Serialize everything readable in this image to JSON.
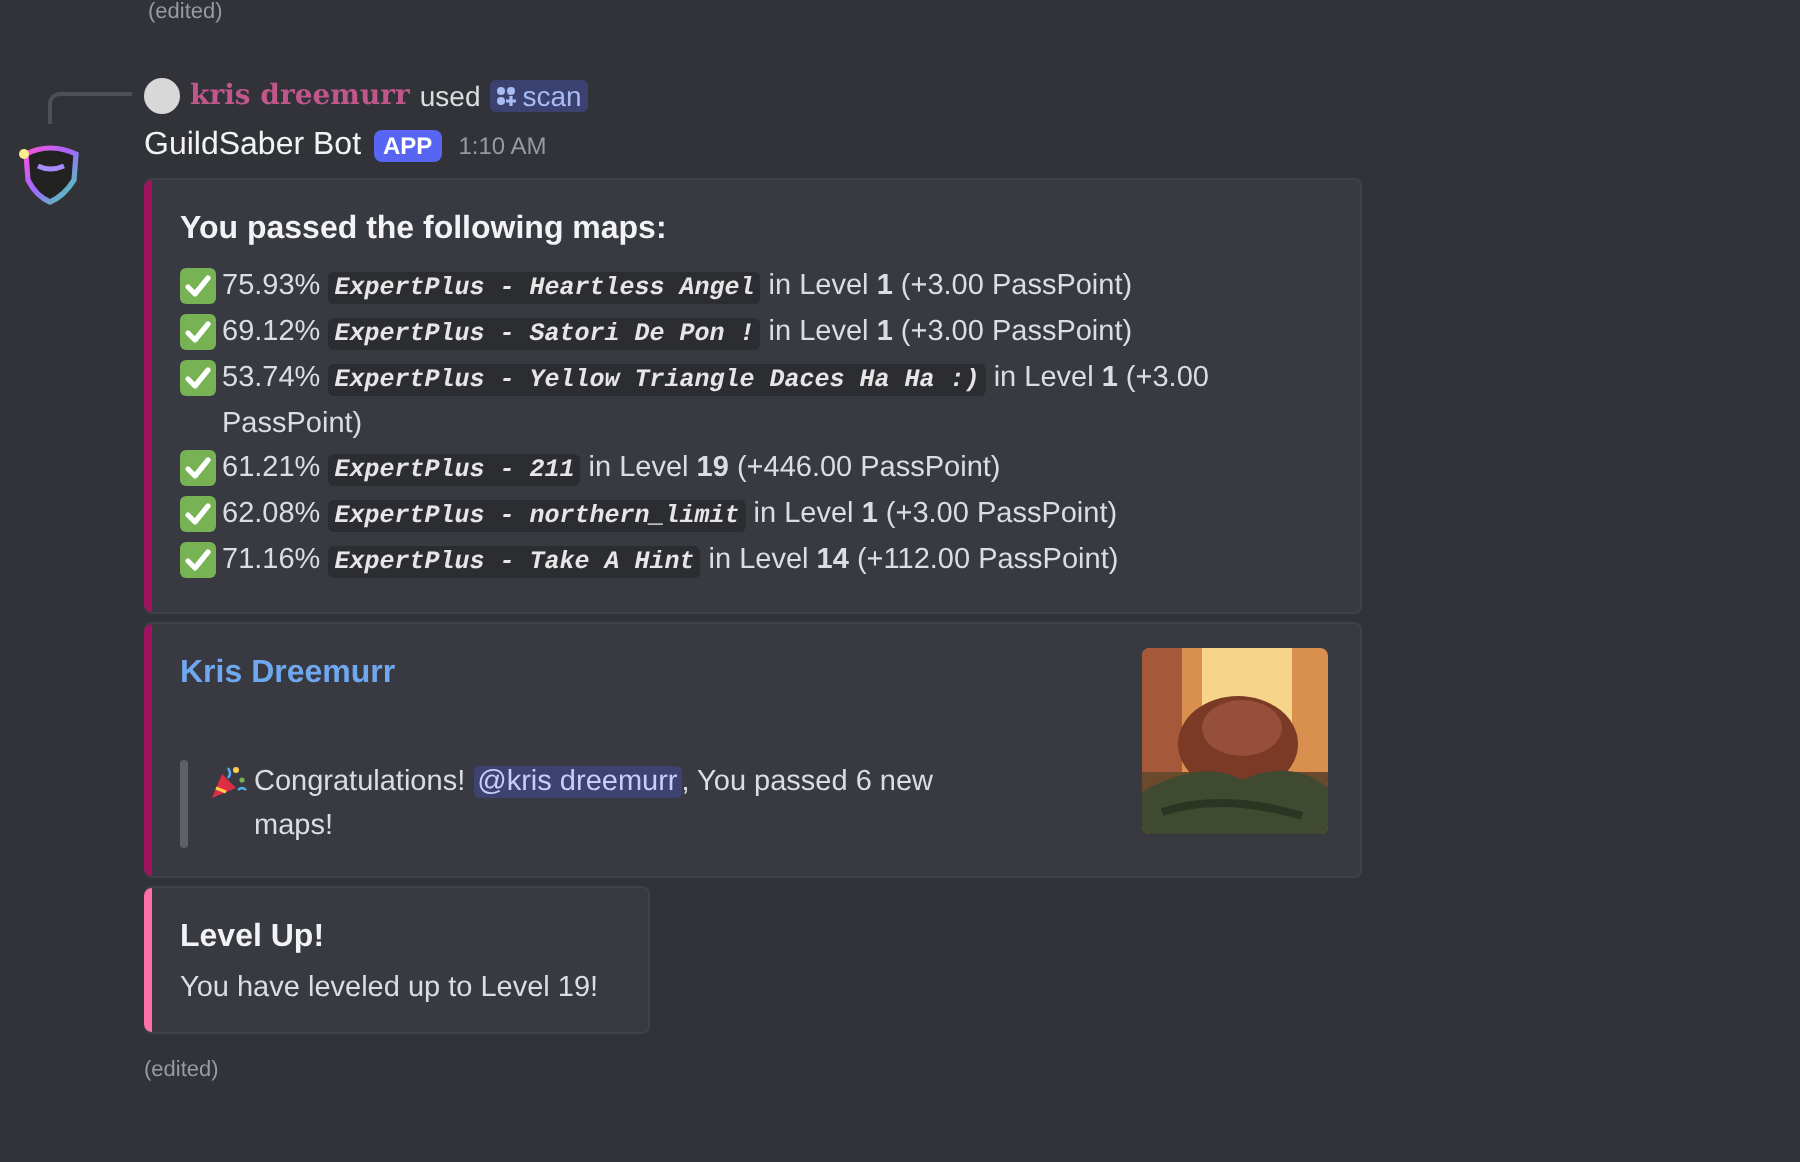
{
  "previous_message": {
    "edited_note": "(edited)"
  },
  "interaction": {
    "user": "kris dreemurr",
    "verb": "used",
    "command": "scan"
  },
  "message": {
    "author": "GuildSaber Bot",
    "badge": "APP",
    "time": "1:10 AM",
    "results_embed": {
      "color": "#a0125f",
      "title": "You passed the following maps:",
      "lines": [
        {
          "percent": "75.93%",
          "map": "ExpertPlus - Heartless Angel",
          "rest": "in Level **1** (+3.00 PassPoint)"
        },
        {
          "percent": "69.12%",
          "map": "ExpertPlus - Satori De Pon !",
          "rest": "in Level **1** (+3.00 PassPoint)"
        },
        {
          "percent": "53.74%",
          "map": "ExpertPlus - Yellow Triangle Daces Ha Ha :)",
          "rest": "in Level **1** (+3.00 PassPoint)"
        },
        {
          "percent": "61.21%",
          "map": "ExpertPlus - 211",
          "rest": "in Level **19** (+446.00 PassPoint)"
        },
        {
          "percent": "62.08%",
          "map": "ExpertPlus - northern_limit",
          "rest": "in Level **1** (+3.00 PassPoint)"
        },
        {
          "percent": "71.16%",
          "map": "ExpertPlus - Take A Hint",
          "rest": "in Level **14** (+112.00 PassPoint)"
        }
      ]
    },
    "congrats_embed": {
      "color": "#a0125f",
      "author": "Kris Dreemurr",
      "quote_before": "Congratulations!",
      "mention": "@kris dreemurr",
      "quote_after": ", You passed 6 new maps!"
    },
    "level_embed": {
      "color": "#ff6fa8",
      "title": "Level Up!",
      "description": "You have leveled up to Level 19!"
    },
    "edited_note": "(edited)"
  }
}
